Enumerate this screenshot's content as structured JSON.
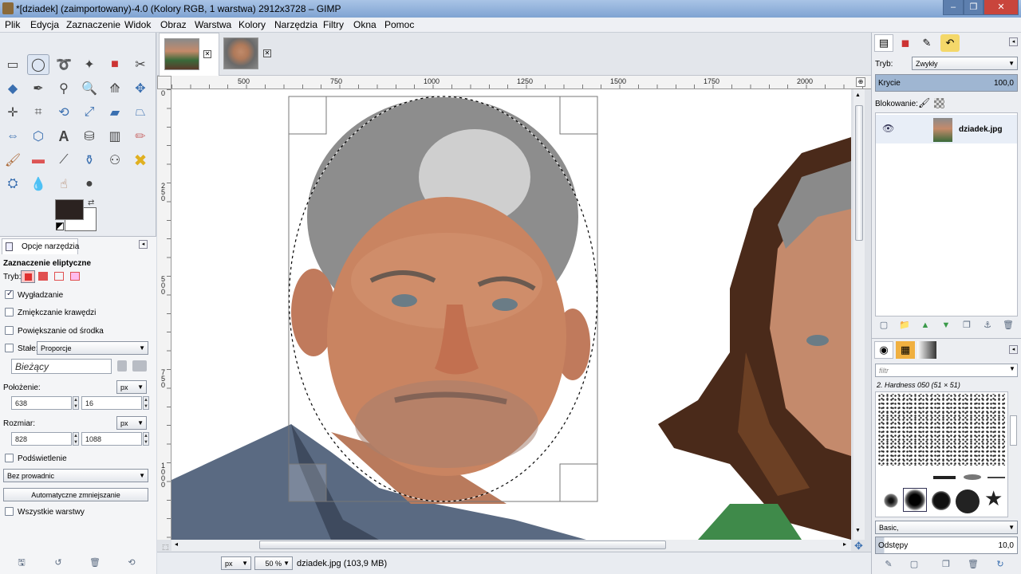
{
  "window": {
    "title": "*[dziadek] (zaimportowany)-4.0 (Kolory RGB, 1 warstwa) 2912x3728 – GIMP"
  },
  "menu": [
    "Plik",
    "Edycja",
    "Zaznaczenie",
    "Widok",
    "Obraz",
    "Warstwa",
    "Kolory",
    "Narzędzia",
    "Filtry",
    "Okna",
    "Pomoc"
  ],
  "tool_options": {
    "tab_label": "Opcje narzędzia",
    "tool_name": "Zaznaczenie eliptyczne",
    "mode_label": "Tryb:",
    "antialias": {
      "label": "Wygładzanie",
      "checked": true
    },
    "feather": {
      "label": "Zmiękczanie krawędzi",
      "checked": false
    },
    "expand_center": {
      "label": "Powiększanie od środka",
      "checked": false
    },
    "fixed": {
      "label": "Stałe:",
      "checked": false,
      "value": "Proporcje"
    },
    "current_value": "Bieżący",
    "position": {
      "label": "Położenie:",
      "x": "638",
      "y": "16",
      "unit": "px"
    },
    "size": {
      "label": "Rozmiar:",
      "w": "828",
      "h": "1088",
      "unit": "px"
    },
    "highlight": {
      "label": "Podświetlenie",
      "checked": false
    },
    "guides": "Bez prowadnic",
    "auto_shrink": "Automatyczne zmniejszanie",
    "all_layers": {
      "label": "Wszystkie warstwy",
      "checked": false
    }
  },
  "ruler": {
    "top": [
      "500",
      "750",
      "1000",
      "1250",
      "1500",
      "1750",
      "2000"
    ],
    "left": [
      "0",
      "250",
      "500",
      "750",
      "1000"
    ]
  },
  "status": {
    "unit": "px",
    "zoom": "50 %",
    "file_info": "dziadek.jpg (103,9 MB)"
  },
  "layers": {
    "mode_label": "Tryb:",
    "mode_value": "Zwykły",
    "opacity_label": "Krycie",
    "opacity_value": "100,0",
    "lock_label": "Blokowanie:",
    "layer_name": "dziadek.jpg"
  },
  "brushes": {
    "filter_placeholder": "filtr",
    "selected_brush": "2. Hardness 050 (51 × 51)",
    "tag": "Basic,",
    "spacing_label": "Odstępy",
    "spacing_value": "10,0"
  },
  "colors": {
    "foreground": "#2b2220",
    "background": "#ffffff",
    "titlebar": "#8fb0db"
  }
}
